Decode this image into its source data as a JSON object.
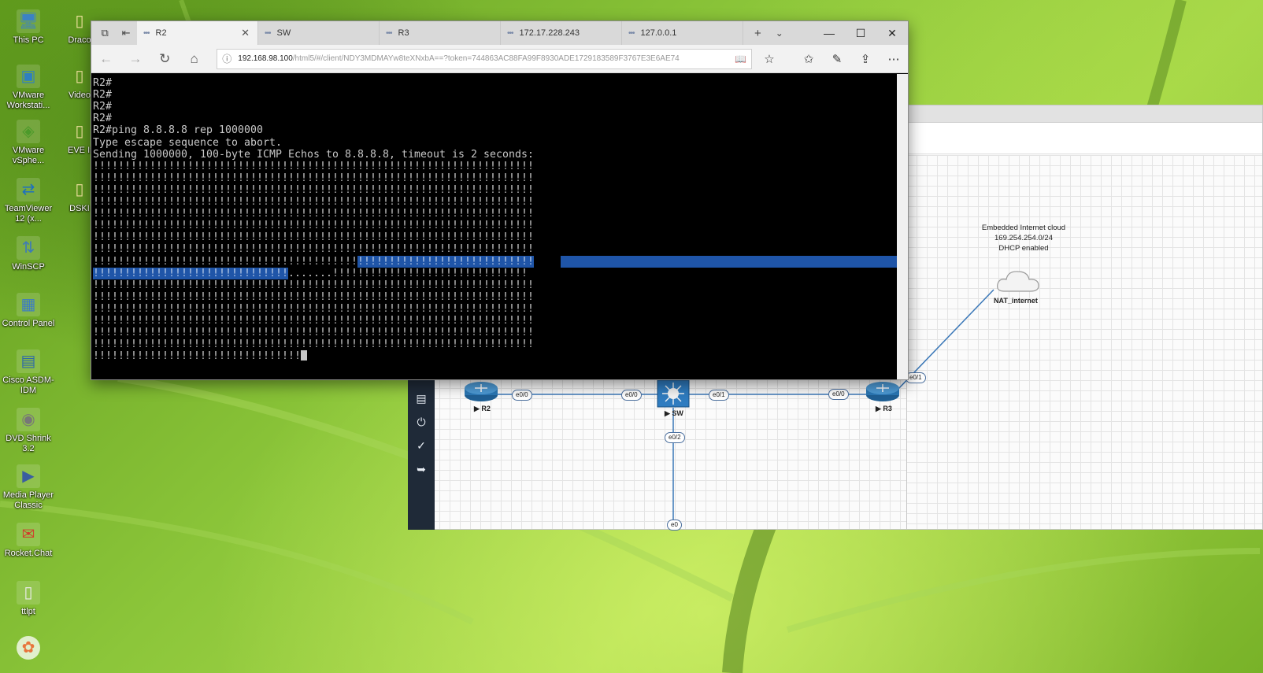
{
  "desktop": {
    "icons": [
      {
        "label": "This PC",
        "glyph": "computer-icon"
      },
      {
        "label": "VMware Workstati...",
        "glyph": "vmware-workstation-icon"
      },
      {
        "label": "VMware vSphe...",
        "glyph": "vmware-vsphere-icon"
      },
      {
        "label": "TeamViewer 12 (x...",
        "glyph": "teamviewer-icon"
      },
      {
        "label": "WinSCP",
        "glyph": "winscp-icon"
      },
      {
        "label": "Control Panel",
        "glyph": "control-panel-icon"
      },
      {
        "label": "Cisco ASDM-IDM",
        "glyph": "cisco-asdm-icon"
      },
      {
        "label": "DVD Shrink 3.2",
        "glyph": "dvd-shrink-icon"
      },
      {
        "label": "Media Player Classic",
        "glyph": "media-player-icon"
      },
      {
        "label": "Rocket.Chat",
        "glyph": "rocket-chat-icon"
      },
      {
        "label": "ttlpt",
        "glyph": "text-file-icon"
      }
    ],
    "icons_col2": [
      {
        "label": "Draco",
        "glyph": "file-icon"
      },
      {
        "label": "Video",
        "glyph": "file-icon"
      },
      {
        "label": "EVE Insta",
        "glyph": "file-icon"
      },
      {
        "label": "DSKI",
        "glyph": "file-icon"
      }
    ]
  },
  "browser": {
    "tabs": [
      {
        "label": "R2",
        "active": true
      },
      {
        "label": "SW",
        "active": false
      },
      {
        "label": "R3",
        "active": false
      },
      {
        "label": "172.17.228.243",
        "active": false
      },
      {
        "label": "127.0.0.1",
        "active": false
      }
    ],
    "url": {
      "host": "192.168.98.100",
      "path": "/html5/#/client/NDY3MDMAYw8teXNxbA==?token=744863AC88FA99F8930ADE1729183589F3767E3E6AE74"
    }
  },
  "terminal": {
    "lines": [
      "R2#",
      "R2#",
      "R2#",
      "R2#",
      "R2#ping 8.8.8.8 rep 1000000",
      "Type escape sequence to abort.",
      "Sending 1000000, 100-byte ICMP Echos to 8.8.8.8, timeout is 2 seconds:",
      "!!!!!!!!!!!!!!!!!!!!!!!!!!!!!!!!!!!!!!!!!!!!!!!!!!!!!!!!!!!!!!!!!!!!!!",
      "!!!!!!!!!!!!!!!!!!!!!!!!!!!!!!!!!!!!!!!!!!!!!!!!!!!!!!!!!!!!!!!!!!!!!!",
      "!!!!!!!!!!!!!!!!!!!!!!!!!!!!!!!!!!!!!!!!!!!!!!!!!!!!!!!!!!!!!!!!!!!!!!",
      "!!!!!!!!!!!!!!!!!!!!!!!!!!!!!!!!!!!!!!!!!!!!!!!!!!!!!!!!!!!!!!!!!!!!!!",
      "!!!!!!!!!!!!!!!!!!!!!!!!!!!!!!!!!!!!!!!!!!!!!!!!!!!!!!!!!!!!!!!!!!!!!!",
      "!!!!!!!!!!!!!!!!!!!!!!!!!!!!!!!!!!!!!!!!!!!!!!!!!!!!!!!!!!!!!!!!!!!!!!",
      "!!!!!!!!!!!!!!!!!!!!!!!!!!!!!!!!!!!!!!!!!!!!!!!!!!!!!!!!!!!!!!!!!!!!!!",
      "!!!!!!!!!!!!!!!!!!!!!!!!!!!!!!!!!!!!!!!!!!!!!!!!!!!!!!!!!!!!!!!!!!!!!!",
      "!!!!!!!!!!!!!!!!!!!!!!!!!!!!!!!!!!!!!!!!!!!!!!!!!!!!!!!!!!!!!!!!!!!!!!",
      "!!!!!!!!!!!!!!!!!!!!!!!!!!!!!!!!!!!!!!!!!!!!!!!!!!!!!!!!!!!!!!!!!!!!!!",
      "!!!!!!!!!!!!!!!!!!!!!!!!!!!!!!!!!!!!!!!!!!!!!!!!!!!!!!!!!!!!!!!!!!!!!!",
      "!!!!!!!!!!!!!!!!!!!!!!!!!!!!!!!!!!!!!!!!!!!!!!!!!!!!!!!!!!!!!!!!!!!!!!",
      "!!!!!!!!!!!!!!!!!!!!!!!!!!!!!!!!!!!!!!!!!!!!!!!!!!!!!!!!!!!!!!!!!!!!!!",
      "!!!!!!!!!!!!!!!!!!!!!!!!!!!!!!!!!!!!!!!!!!!!!!!!!!!!!!!!!!!!!!!!!!!!!!",
      "!!!!!!!!!!!!!!!!!!!!!!!!!!!!!!!!!"
    ],
    "selected_line_a": {
      "before": "!!!!!!!!!!!!!!!!!!!!!!!!!!!!!!!!!!!!!!!!!!",
      "selected": "!!!!!!!!!!!!!!!!!!!!!!!!!!!!"
    },
    "selected_line_b": {
      "selected": "!!!!!!!!!!!!!!!!!!!!!!!!!!!!!!!",
      "after": ".......!!!!!!!!!!!!!!!!!!!!!!!!!!!!!!!"
    }
  },
  "topology": {
    "cloud": {
      "caption_lines": [
        "Embedded Internet cloud",
        "169.254.254.0/24",
        "DHCP enabled"
      ],
      "name": "NAT_internet"
    },
    "nodes": [
      {
        "label": "R2"
      },
      {
        "label": "SW"
      },
      {
        "label": "R3"
      }
    ],
    "interfaces": [
      "e0/0",
      "e0/0",
      "e0/1",
      "e0/0",
      "e0/1",
      "e0/2",
      "e0"
    ]
  },
  "colors": {
    "terminal_bg": "#000000",
    "terminal_fg": "#c8c8c8",
    "selection": "#1f55a8",
    "dock": "#1f2a38"
  }
}
